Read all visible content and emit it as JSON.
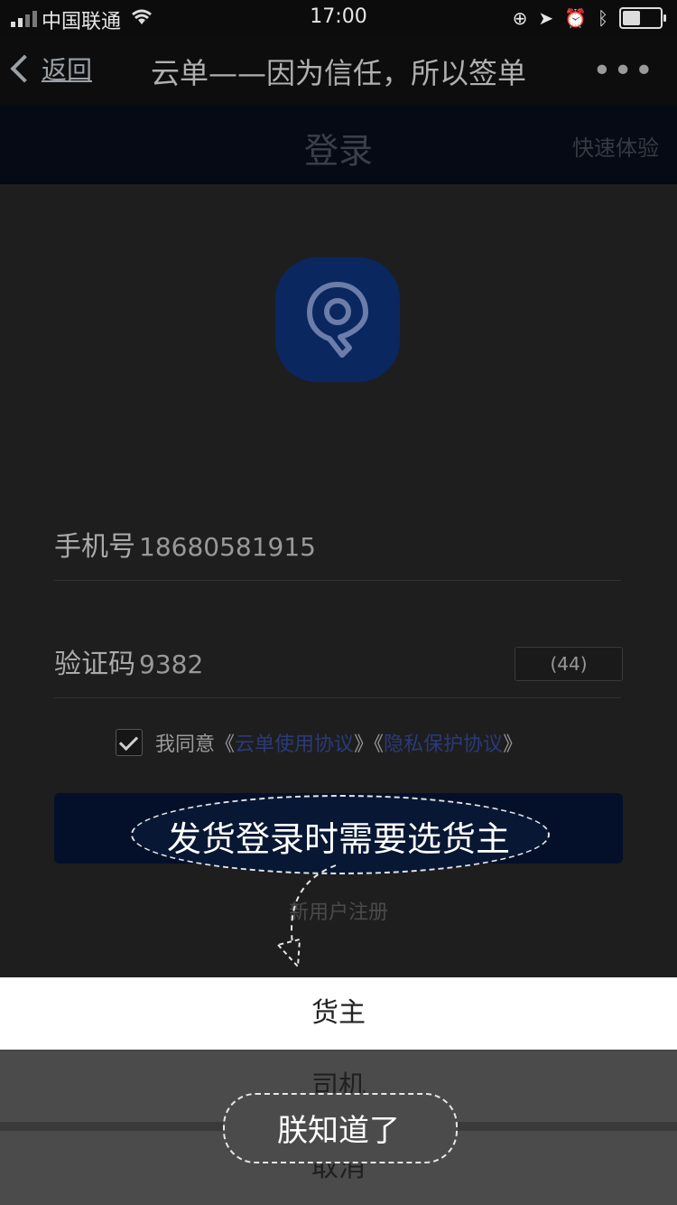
{
  "status_bar": {
    "carrier": "中国联通",
    "time": "17:00",
    "battery_level": 0.5
  },
  "navbar": {
    "back_label": "返回",
    "title": "云单——因为信任，所以签单",
    "more_label": "•••"
  },
  "header": {
    "title": "登录",
    "quick_label": "快速体验"
  },
  "form": {
    "phone_label": "手机号",
    "phone_value": "18680581915",
    "code_label": "验证码",
    "code_value": "9382",
    "countdown_label": "(44)",
    "agree_prefix": "我同意《",
    "agree_link1": "云单使用协议",
    "agree_mid": "》《",
    "agree_link2": "隐私保护协议",
    "agree_suffix": "》",
    "register_label": "新用户注册"
  },
  "callouts": {
    "tip_role": "发货登录时需要选货主",
    "tip_ok": "朕知道了"
  },
  "action_sheet": {
    "option_shipper": "货主",
    "option_driver": "司机",
    "cancel": "取消"
  },
  "colors": {
    "brand_blue": "#0a2760",
    "login_button": "#041029",
    "link": "#2a3a7a"
  }
}
